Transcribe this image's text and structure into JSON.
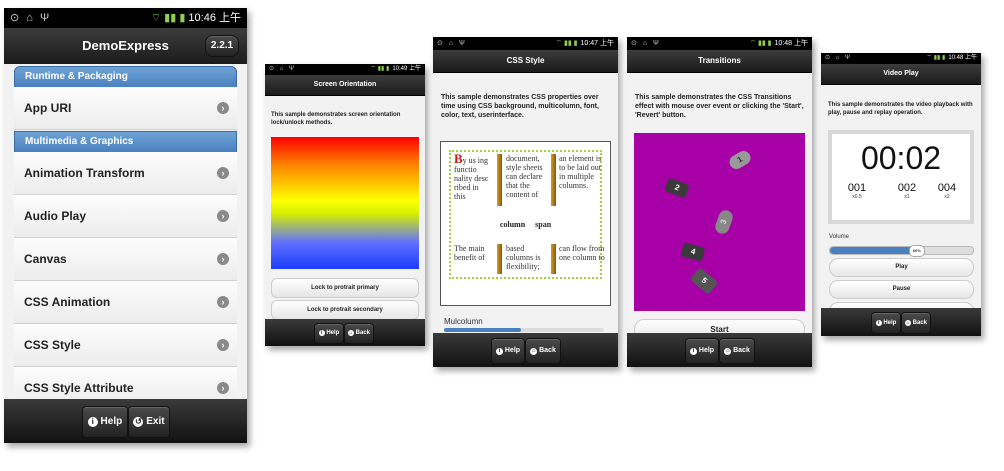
{
  "status": {
    "left_icons": "⊙ ⌂ Ψ",
    "signal": "⌔ ▮▮ ▮"
  },
  "phone1": {
    "time": "10:46 上午",
    "title": "DemoExpress",
    "version": "2.2.1",
    "dividers": [
      "Runtime & Packaging",
      "Multimedia & Graphics"
    ],
    "items": [
      "App URI",
      "Animation Transform",
      "Audio Play",
      "Canvas",
      "CSS Animation",
      "CSS Style",
      "CSS Style Attribute"
    ],
    "footer": {
      "help": "Help",
      "exit": "Exit"
    }
  },
  "phone2": {
    "time": "10:49 上午",
    "title": "Screen Orientation",
    "description": "This sample demonstrates screen orientation lock/unlock methods.",
    "buttons": [
      "Lock to protrait primary",
      "Lock to protrait secondary"
    ],
    "footer": {
      "help": "Help",
      "back": "Back"
    }
  },
  "phone3": {
    "time": "10:47 上午",
    "title": "CSS Style",
    "description": "This sample demonstrates CSS properties over time using CSS background, multicolumn, font, color, text, userinterface.",
    "dropcap": "B",
    "col1_top": "y us ing functio nality desc ribed in this",
    "col2_top": "document, style sheets can declare that the content of",
    "col3_top": "an element is to be laid out in multiple columns.",
    "span_label": "column span",
    "col1_bottom": "The main benefit of",
    "col2_bottom": "based columns is flexibility;",
    "col3_bottom": "can flow from one column to",
    "section_label": "Mulcolumn",
    "footer": {
      "help": "Help",
      "back": "Back"
    }
  },
  "phone4": {
    "time": "10:48 上午",
    "title": "Transitions",
    "description": "This sample demonstrates the CSS Transitions effect with mouse over event or clicking the 'Start', 'Revert' button.",
    "canvas_color": "#a600a6",
    "boxes": [
      "1",
      "2",
      "3",
      "4",
      "5"
    ],
    "start_button": "Start",
    "footer": {
      "help": "Help",
      "back": "Back"
    }
  },
  "phone5": {
    "time": "10:48 上午",
    "title": "Video Play",
    "description": "This sample demonstrates the video playback with play, pause and replay operation.",
    "clock": "00:02",
    "counters": [
      {
        "value": "001",
        "sub": "x0.5"
      },
      {
        "value": "002",
        "sub": "x1"
      },
      {
        "value": "004",
        "sub": "x2"
      }
    ],
    "volume_label": "Volume",
    "volume_value": "60%",
    "volume_level": 0.6,
    "buttons": [
      "Play",
      "Pause"
    ],
    "footer": {
      "help": "Help",
      "back": "Back"
    }
  },
  "colors": {
    "accent_blue": "#4a80bf",
    "magenta": "#a600a6"
  }
}
